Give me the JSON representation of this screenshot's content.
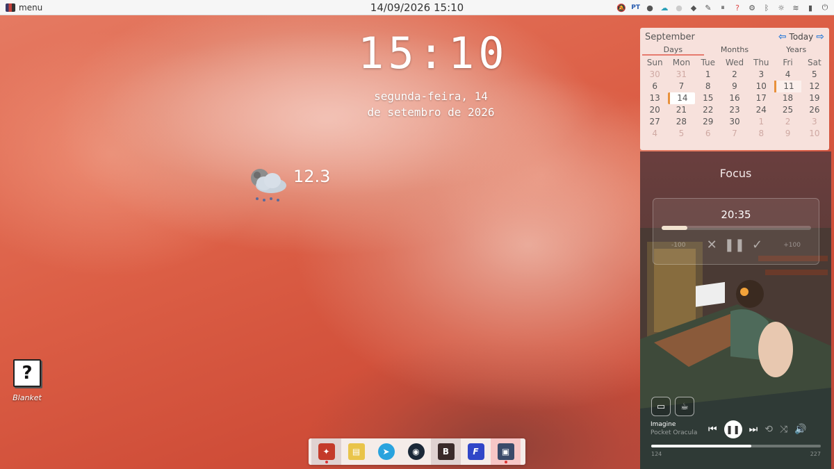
{
  "topbar": {
    "menu_label": "menu",
    "datetime": "14/09/2026 15:10",
    "tray": {
      "lang": "PT",
      "icons": [
        "bell-off-icon",
        "circle-icon",
        "cloud-icon",
        "circle-gray-icon",
        "shield-icon",
        "pen-icon",
        "pause-circle-icon",
        "help-icon",
        "gear-icon",
        "bluetooth-icon",
        "brightness-icon",
        "wifi-icon",
        "battery-icon",
        "power-icon"
      ]
    }
  },
  "desktop": {
    "clock": "15:10",
    "date_line1": "segunda-feira, 14",
    "date_line2": "de setembro de 2026",
    "weather_temp": "12.3",
    "icon_label": "Blanket"
  },
  "calendar": {
    "month": "September",
    "today_label": "Today",
    "tabs": [
      "Days",
      "Months",
      "Years"
    ],
    "weekdays": [
      "Sun",
      "Mon",
      "Tue",
      "Wed",
      "Thu",
      "Fri",
      "Sat"
    ],
    "weeks": [
      [
        "30",
        "31",
        "1",
        "2",
        "3",
        "4",
        "5"
      ],
      [
        "6",
        "7",
        "8",
        "9",
        "10",
        "11",
        "12"
      ],
      [
        "13",
        "14",
        "15",
        "16",
        "17",
        "18",
        "19"
      ],
      [
        "20",
        "21",
        "22",
        "23",
        "24",
        "25",
        "26"
      ],
      [
        "27",
        "28",
        "29",
        "30",
        "1",
        "2",
        "3"
      ],
      [
        "4",
        "5",
        "6",
        "7",
        "8",
        "9",
        "10"
      ]
    ]
  },
  "player": {
    "title": "Focus",
    "timer": "20:35",
    "timer_progress": 0.17,
    "minus_label": "-100",
    "plus_label": "+100",
    "track_title": "Imagine",
    "track_artist": "Pocket Oracula",
    "time_elapsed": "124",
    "time_total": "227",
    "seek_progress": 0.59
  },
  "dock": {
    "items": [
      "app-red-icon",
      "files-icon",
      "telegram-icon",
      "steam-icon",
      "bitwarden-icon",
      "f-app-icon",
      "screenshot-icon"
    ]
  },
  "colors": {
    "accent": "#e8913c",
    "nav_arrow": "#2a7ad8",
    "wallpaper": "#dc5f46"
  }
}
